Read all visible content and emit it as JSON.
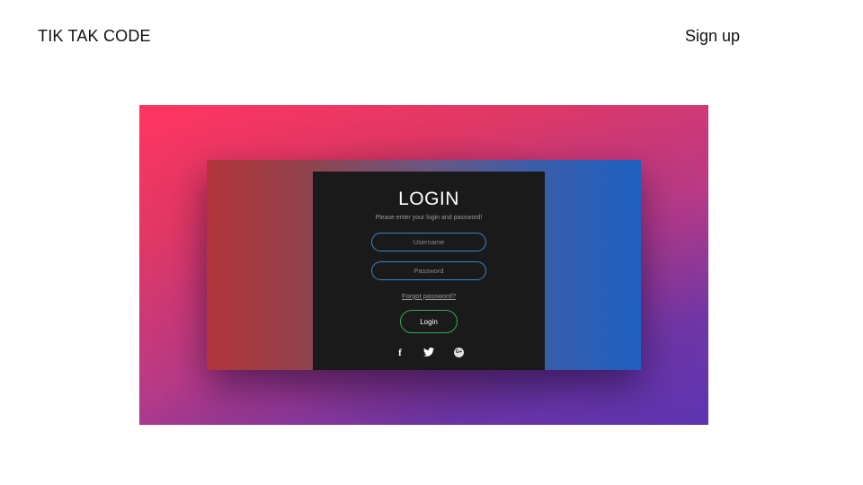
{
  "header": {
    "brand": "TIK TAK CODE",
    "signup_label": "Sign up"
  },
  "login_card": {
    "title": "LOGIN",
    "subtitle": "Please enter your login and password!",
    "username_placeholder": "Username",
    "password_placeholder": "Password",
    "forgot_label": "Forgot password?",
    "login_button_label": "Login",
    "social_icons": [
      "facebook-icon",
      "twitter-icon",
      "google-plus-icon"
    ],
    "google_plus_glyph": "G+"
  },
  "colors": {
    "background_gradient": [
      "#ff3560",
      "#5e34b2"
    ],
    "panel_gradient": [
      "#b3343a",
      "#1e5fc2"
    ],
    "card_background": "#1a1a1a",
    "input_border": "#3a86c8",
    "login_button_border": "#2faa5a"
  }
}
